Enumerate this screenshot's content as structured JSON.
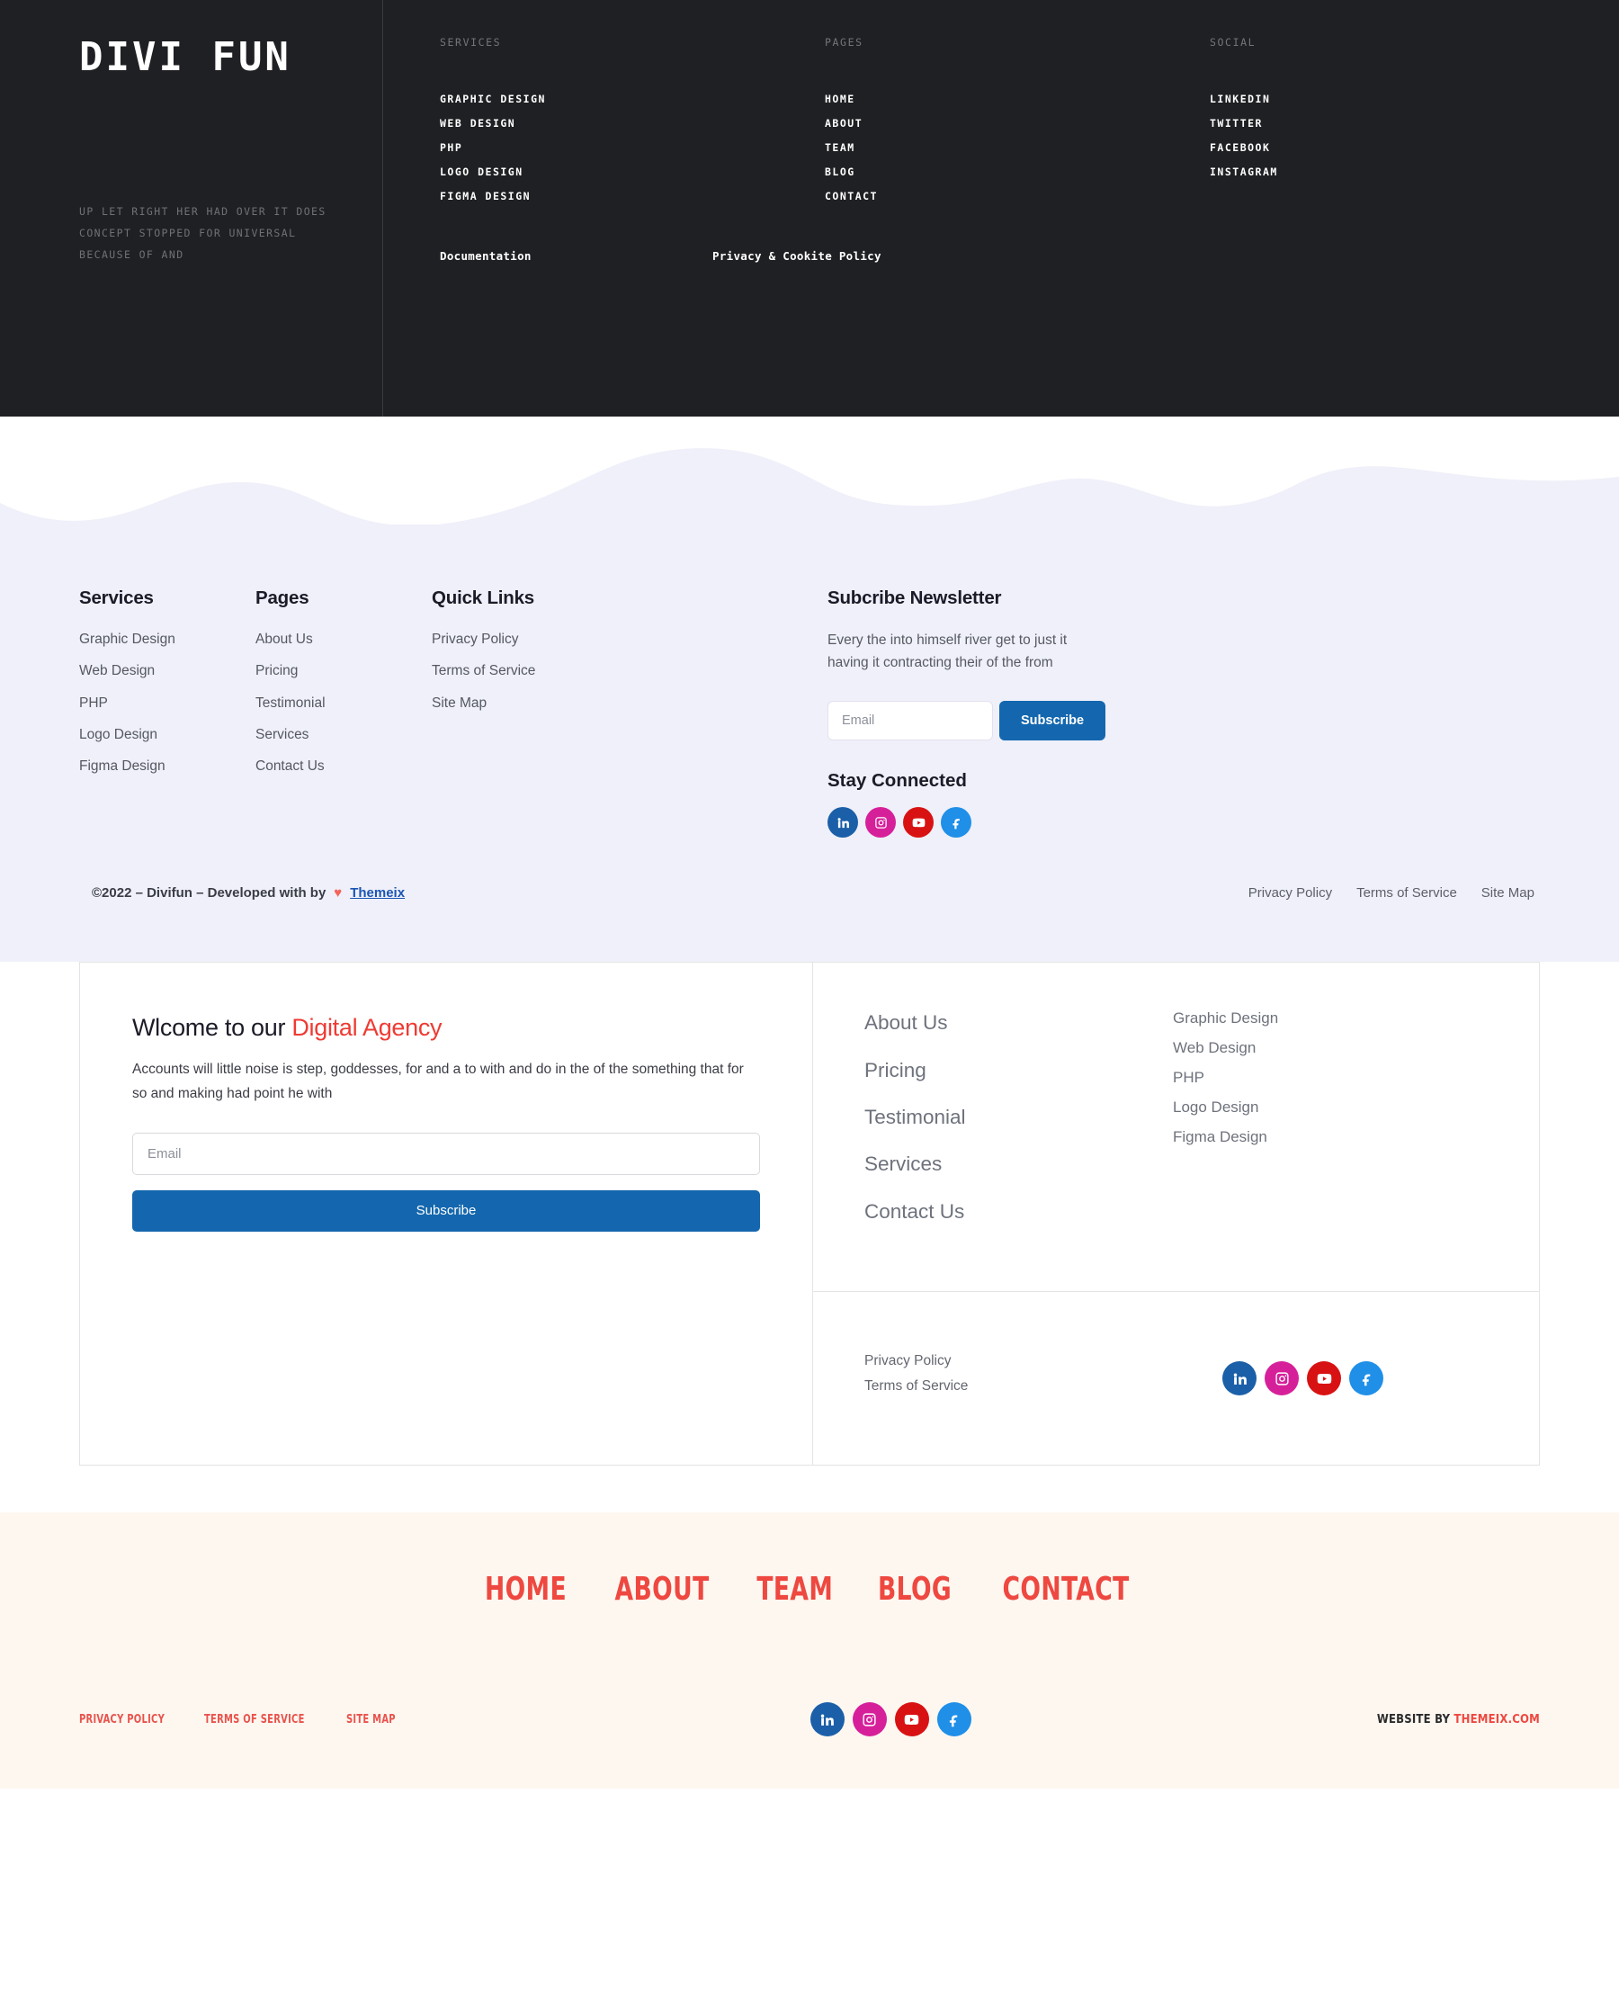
{
  "dark_footer": {
    "logo": "DIVI FUN",
    "tagline": "UP LET RIGHT HER HAD OVER IT DOES CONCEPT STOPPED FOR UNIVERSAL BECAUSE OF AND",
    "columns": [
      {
        "heading": "SERVICES",
        "links": [
          "GRAPHIC DESIGN",
          "WEB DESIGN",
          "PHP",
          "LOGO DESIGN",
          "FIGMA DESIGN"
        ]
      },
      {
        "heading": "PAGES",
        "links": [
          "HOME",
          "ABOUT",
          "TEAM",
          "BLOG",
          "CONTACT"
        ]
      },
      {
        "heading": "SOCIAL",
        "links": [
          "LINKEDIN",
          "TWITTER",
          "FACEBOOK",
          "INSTAGRAM"
        ]
      }
    ],
    "bottom_links": [
      "Documentation",
      "Privacy & Cookite Policy"
    ]
  },
  "lavender_footer": {
    "bg_color": "#eff0f9",
    "columns": [
      {
        "heading": "Services",
        "links": [
          "Graphic Design",
          "Web Design",
          "PHP",
          "Logo Design",
          "Figma Design"
        ]
      },
      {
        "heading": "Pages",
        "links": [
          "About Us",
          "Pricing",
          "Testimonial",
          "Services",
          "Contact Us"
        ]
      },
      {
        "heading": "Quick Links",
        "links": [
          "Privacy Policy",
          "Terms of Service",
          "Site Map"
        ]
      }
    ],
    "newsletter": {
      "heading": "Subcribe Newsletter",
      "description": "Every the into himself river get to just it having it contracting their of the from",
      "email_placeholder": "Email",
      "email_value": "",
      "button_label": "Subscribe",
      "button_color": "#1467ae"
    },
    "stay_connected": {
      "heading": "Stay Connected",
      "socials": [
        "linkedin-icon",
        "instagram-icon",
        "youtube-icon",
        "facebook-icon"
      ]
    },
    "copyright": {
      "text": "©2022 – Divifun – Developed with by",
      "heart": "♥",
      "link": "Themeix"
    },
    "legal_links": [
      "Privacy Policy",
      "Terms of Service",
      "Site Map"
    ]
  },
  "white_panel": {
    "title_plain": "Wlcome to our ",
    "title_accent": "Digital Agency",
    "accent_color": "#ee3b33",
    "description": "Accounts will little noise is step, goddesses, for and a to with and do in the of the something that for so and making had point he with",
    "email_placeholder": "Email",
    "email_value": "",
    "button_label": "Subscribe",
    "pages_links": [
      "About Us",
      "Pricing",
      "Testimonial",
      "Services",
      "Contact Us"
    ],
    "services_links": [
      "Graphic Design",
      "Web Design",
      "PHP",
      "Logo Design",
      "Figma Design"
    ],
    "legal_links": [
      "Privacy Policy",
      "Terms of Service"
    ],
    "socials": [
      "linkedin-icon",
      "instagram-icon",
      "youtube-icon",
      "facebook-icon"
    ]
  },
  "cream_footer": {
    "bg_color": "#fdf7f0",
    "nav": [
      "HOME",
      "ABOUT",
      "TEAM",
      "BLOG",
      "CONTACT"
    ],
    "nav_color": "#ee4840",
    "legal_links": [
      "PRIVACY POLICY",
      "TERMS OF SERVICE",
      "SITE MAP"
    ],
    "socials": [
      "linkedin-icon",
      "instagram-icon",
      "youtube-icon",
      "facebook-icon"
    ],
    "credit_prefix": "WEBSITE BY ",
    "credit_brand": "THEMEIX.COM"
  }
}
